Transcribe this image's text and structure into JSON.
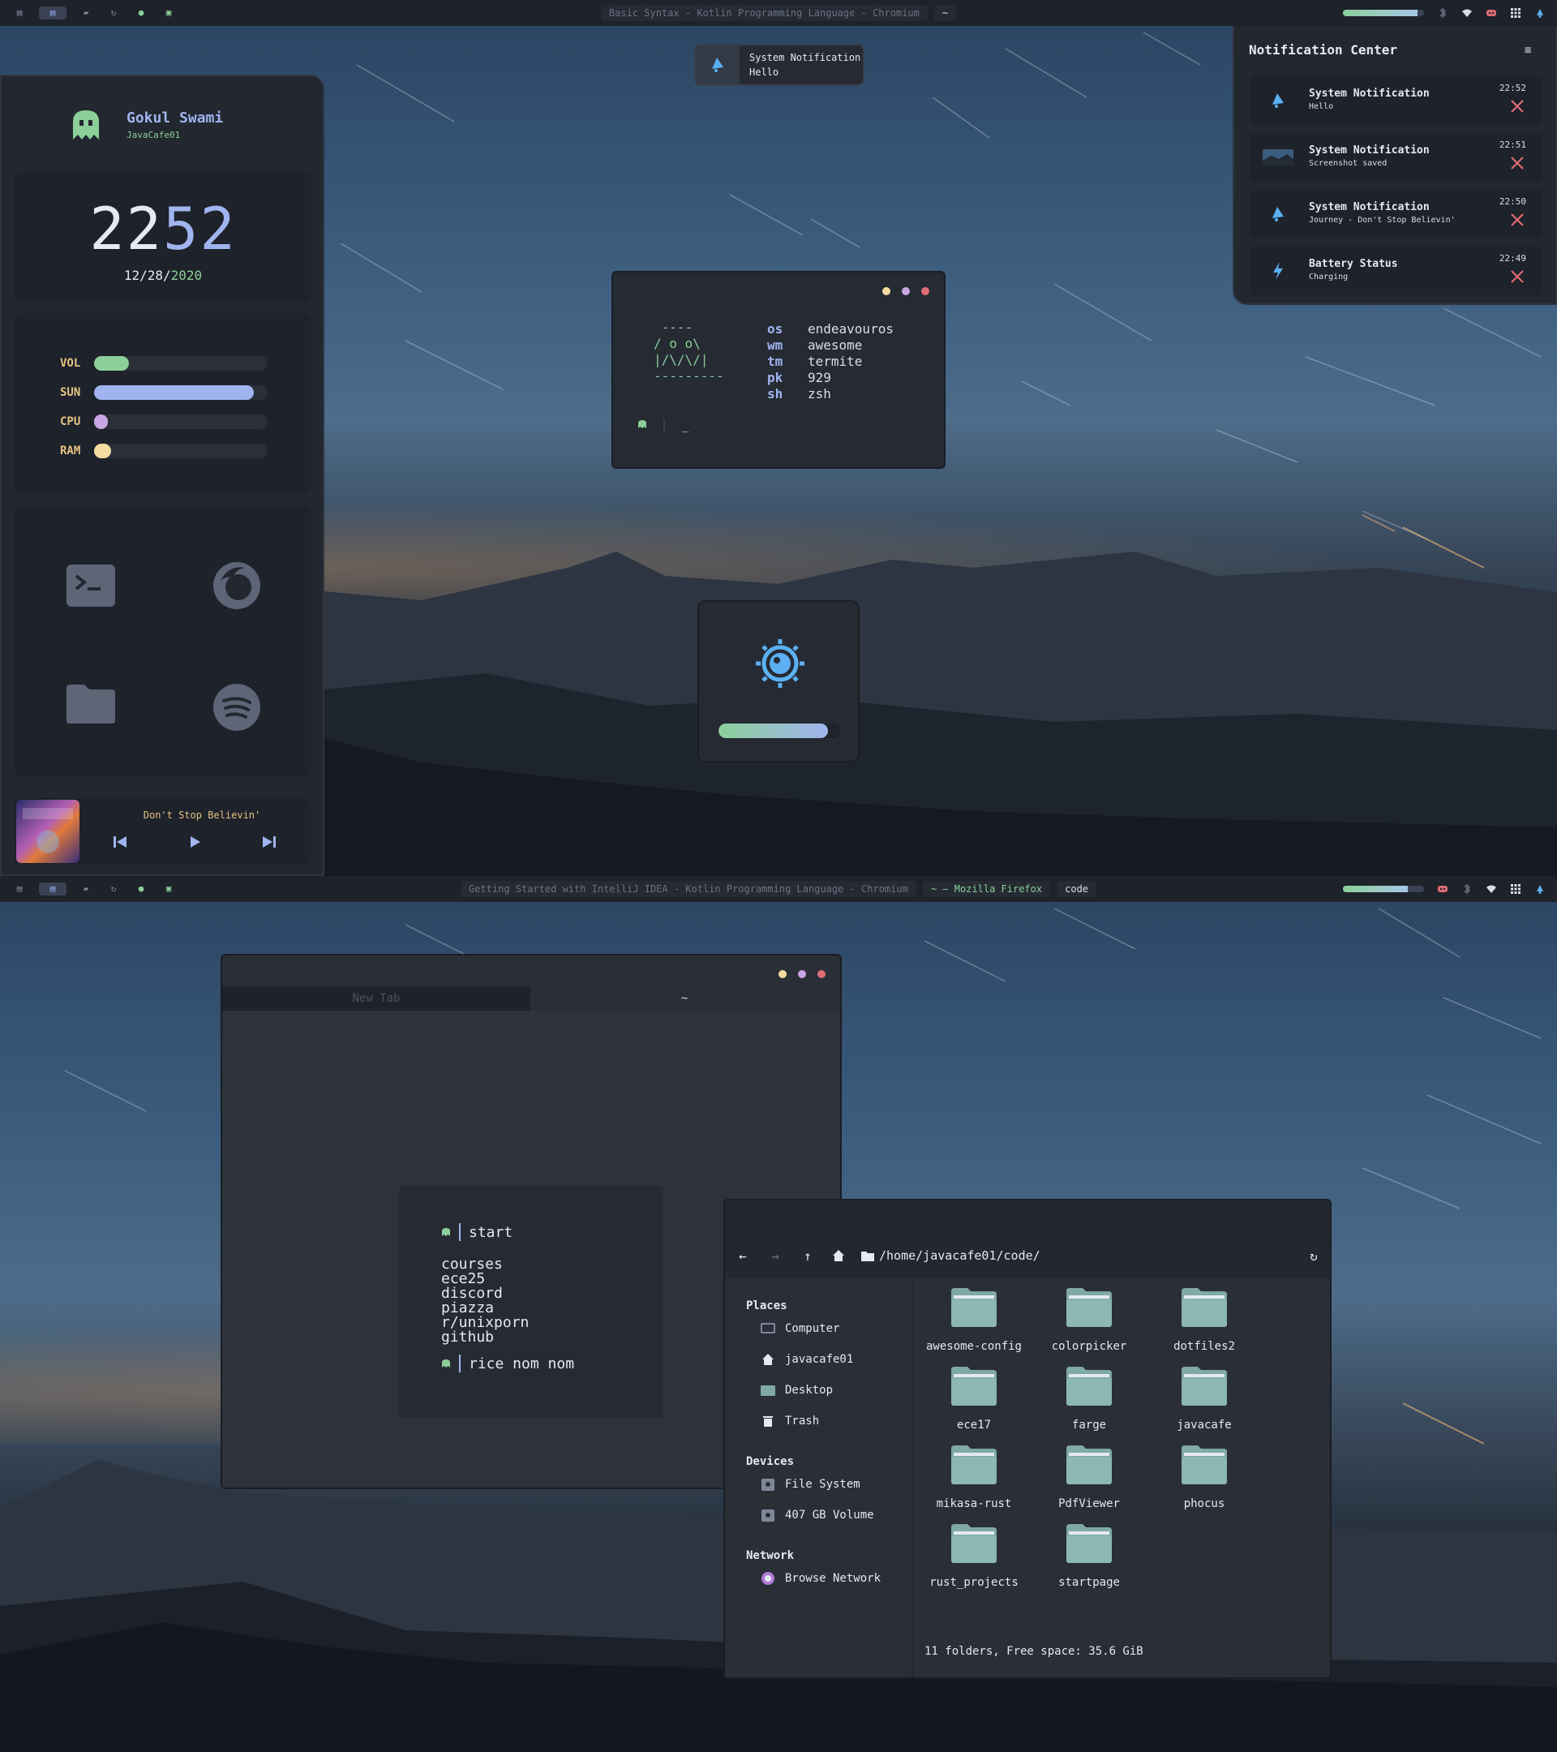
{
  "top_screen": {
    "bar": {
      "workspace_active": "▤",
      "window_title": "Basic Syntax - Kotlin Programming Language - Chromium",
      "window_title_2": "~",
      "volume_level": 0.92
    },
    "profile": {
      "name": "Gokul Swami",
      "handle": "JavaCafe01"
    },
    "clock": {
      "time_hours": "22",
      "time_minutes": "52",
      "date_prefix": "12/",
      "date_mid": "28/",
      "date_year": "2020"
    },
    "stats": [
      {
        "label": "VOL",
        "value": 0.2,
        "color": "#8ccf9a"
      },
      {
        "label": "SUN",
        "value": 0.92,
        "color": "#a0b4ef"
      },
      {
        "label": "CPU",
        "value": 0.06,
        "color": "#c9a6e5"
      },
      {
        "label": "RAM",
        "value": 0.1,
        "color": "#f6dca0"
      }
    ],
    "apps": [
      "terminal-icon",
      "firefox-icon",
      "folder-icon",
      "spotify-icon"
    ],
    "media": {
      "song": "Don't Stop Believin'",
      "prev": "prev-icon",
      "play": "play-icon",
      "next": "next-icon"
    },
    "popup": {
      "title": "System Notification",
      "message": "Hello"
    },
    "fetch": {
      "art": " ----\n/ o o\\\n|/\\/\\/|\n---------",
      "rows": [
        {
          "key": "os",
          "value": "endeavouros"
        },
        {
          "key": "wm",
          "value": "awesome"
        },
        {
          "key": "tm",
          "value": "termite"
        },
        {
          "key": "pk",
          "value": "929"
        },
        {
          "key": "sh",
          "value": "zsh"
        }
      ],
      "prompt_cursor": "_"
    },
    "brightness": {
      "level": 0.9
    },
    "notification_center": {
      "title": "Notification Center",
      "items": [
        {
          "title": "System Notification",
          "message": "Hello",
          "time": "22:52",
          "icon": "bell-icon"
        },
        {
          "title": "System Notification",
          "message": "Screenshot saved",
          "time": "22:51",
          "icon": "screenshot-thumbnail"
        },
        {
          "title": "System Notification",
          "message": "Journey - Don't Stop Believin'",
          "time": "22:50",
          "icon": "bell-icon"
        },
        {
          "title": "Battery Status",
          "message": "Charging",
          "time": "22:49",
          "icon": "bolt-icon"
        }
      ]
    }
  },
  "bottom_screen": {
    "bar": {
      "window_title": "Getting Started with IntelliJ IDEA - Kotlin Programming Language - Chromium",
      "window_title_2": "~ — Mozilla Firefox",
      "window_title_3": "code",
      "volume_level": 0.8
    },
    "browser": {
      "tab1": "New Tab",
      "tab2": "~",
      "start_prompt": "start",
      "links": [
        "courses",
        "ece25",
        "discord",
        "piazza",
        "r/unixporn",
        "github"
      ],
      "search_prompt": "rice nom nom"
    },
    "file_manager": {
      "path": "/home/javacafe01/code/",
      "places_header": "Places",
      "places": [
        "Computer",
        "javacafe01",
        "Desktop",
        "Trash"
      ],
      "devices_header": "Devices",
      "devices": [
        "File System",
        "407 GB Volume"
      ],
      "network_header": "Network",
      "network": [
        "Browse Network"
      ],
      "folders": [
        "awesome-config",
        "colorpicker",
        "dotfiles2",
        "ece17",
        "farge",
        "javacafe",
        "mikasa-rust",
        "PdfViewer",
        "phocus",
        "rust_projects",
        "startpage"
      ],
      "status": "11 folders, Free space: 35.6 GiB"
    }
  },
  "colors": {
    "accent_green": "#8ccf9a",
    "accent_blue": "#a0b4ef",
    "accent_purple": "#c9a6e5",
    "accent_yellow": "#f6dca0",
    "close_red": "#e06c75",
    "folder_teal": "#7fa9a6"
  }
}
